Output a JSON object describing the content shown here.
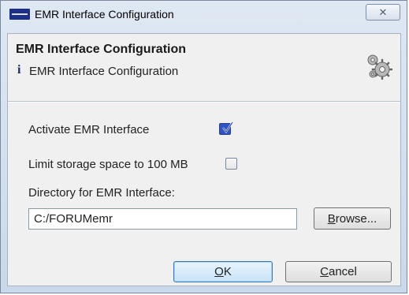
{
  "window": {
    "title": "EMR Interface Configuration",
    "close_glyph": "✕"
  },
  "header": {
    "title": "EMR Interface Configuration",
    "info_glyph": "i",
    "subtitle": "EMR Interface Configuration"
  },
  "form": {
    "activate_label": "Activate EMR Interface",
    "activate_checked": true,
    "limit_label": "Limit storage space to 100 MB",
    "limit_checked": false,
    "directory_label": "Directory for EMR Interface:",
    "directory_value": "C:/FORUMemr"
  },
  "buttons": {
    "browse_mnemonic": "B",
    "browse_rest": "rowse...",
    "ok_mnemonic": "O",
    "ok_rest": "K",
    "cancel_mnemonic": "C",
    "cancel_rest": "ancel"
  },
  "colors": {
    "checkbox_checked": "#2f54c7",
    "logo": "#1b2f8a",
    "ok_border": "#3d7bad"
  },
  "icons": [
    "zeiss-logo-icon",
    "close-icon",
    "info-icon",
    "gear-icon",
    "checkmark-icon"
  ]
}
